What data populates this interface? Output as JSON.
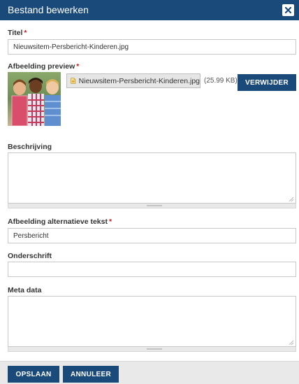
{
  "dialog": {
    "title": "Bestand bewerken",
    "close_icon": "close-icon"
  },
  "fields": {
    "title": {
      "label": "Titel",
      "required_mark": "*",
      "value": "Nieuwsitem-Persbericht-Kinderen.jpg"
    },
    "image_preview": {
      "label": "Afbeelding preview",
      "required_mark": "*",
      "file_icon": "image-file-icon",
      "file_name": "Nieuwsitem-Persbericht-Kinderen.jpg",
      "file_size": "(25.99 KB)",
      "remove_label": "VERWIJDER"
    },
    "description": {
      "label": "Beschrijving",
      "value": ""
    },
    "alt_text": {
      "label": "Afbeelding alternatieve tekst",
      "required_mark": "*",
      "value": "Persbericht"
    },
    "caption": {
      "label": "Onderschrift",
      "value": ""
    },
    "meta_data": {
      "label": "Meta data",
      "value": ""
    }
  },
  "footer": {
    "save_label": "OPSLAAN",
    "cancel_label": "ANNULEER"
  },
  "colors": {
    "brand": "#1a4a7a",
    "required": "#d01818"
  }
}
